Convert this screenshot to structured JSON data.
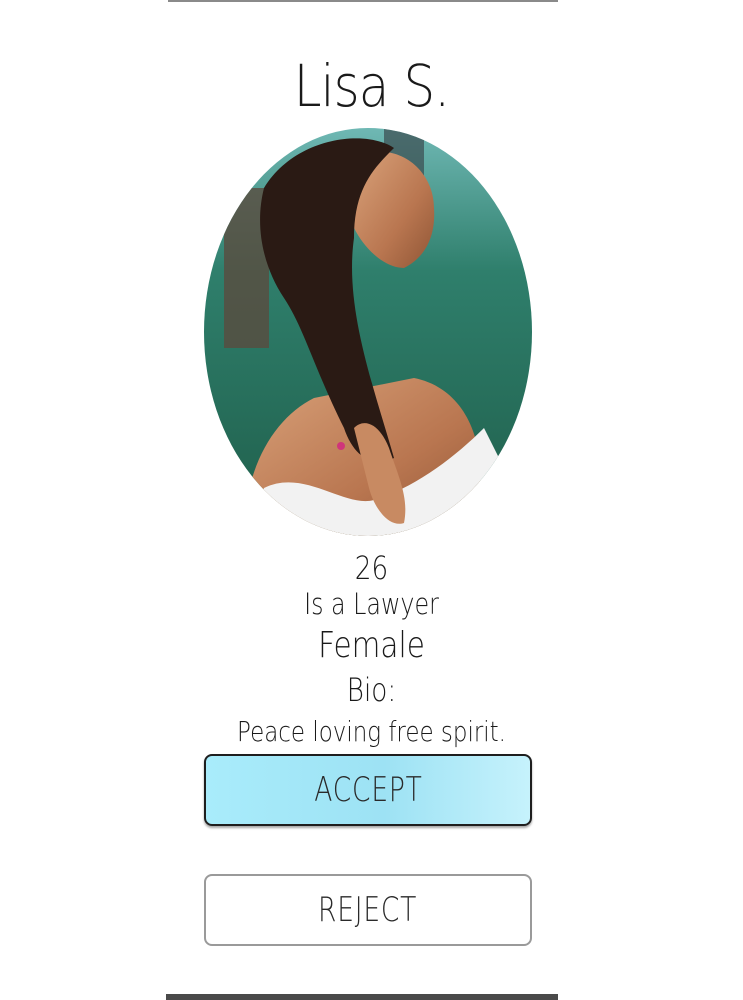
{
  "profile": {
    "name": "Lisa S.",
    "age": "26",
    "occupation": "Is a Lawyer",
    "gender": "Female",
    "bio_label": "Bio:",
    "bio": "Peace loving free spirit."
  },
  "actions": {
    "accept_label": "ACCEPT",
    "reject_label": "REJECT"
  },
  "colors": {
    "accept_fill": "#a9ecfb",
    "accept_border": "#1e1e1e",
    "reject_border": "#9a9a9a",
    "bottom_bar": "#4a4a4a"
  },
  "icons": {
    "profile_photo": "profile-photo"
  }
}
